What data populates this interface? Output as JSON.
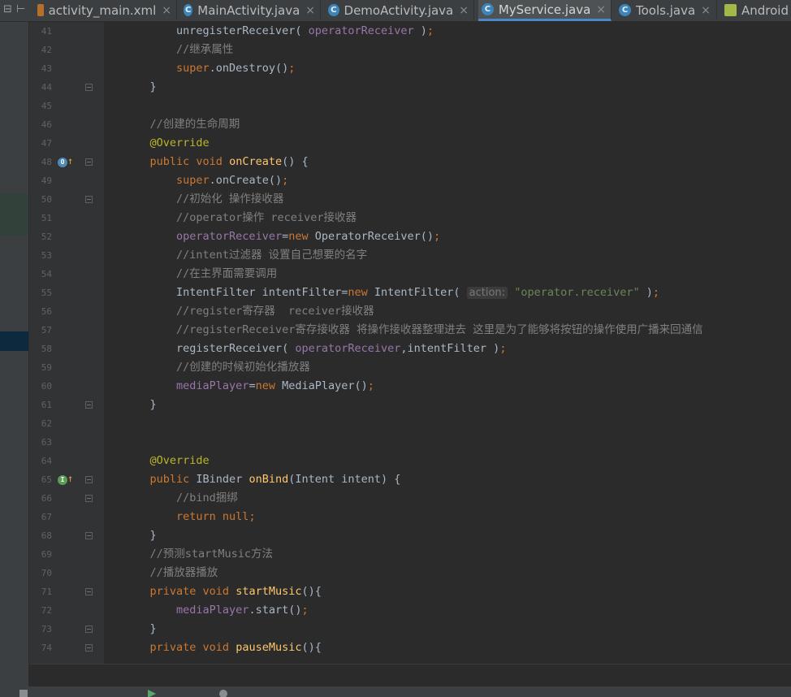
{
  "tabs": [
    {
      "label": "activity_main.xml",
      "icon": "xml-file-icon",
      "active": false
    },
    {
      "label": "MainActivity.java",
      "icon": "class-icon",
      "active": false
    },
    {
      "label": "DemoActivity.java",
      "icon": "class-icon",
      "active": false
    },
    {
      "label": "MyService.java",
      "icon": "class-icon",
      "active": true
    },
    {
      "label": "Tools.java",
      "icon": "class-icon",
      "active": false
    },
    {
      "label": "Android",
      "icon": "android-icon",
      "active": false
    }
  ],
  "tab_close_glyph": "×",
  "class_glyph": "C",
  "gutter": {
    "line_numbers": [
      "41",
      "42",
      "43",
      "44",
      "45",
      "46",
      "47",
      "48",
      "49",
      "50",
      "51",
      "52",
      "53",
      "54",
      "55",
      "56",
      "57",
      "58",
      "59",
      "60",
      "61",
      "62",
      "63",
      "64",
      "65",
      "66",
      "67",
      "68",
      "69",
      "70",
      "71",
      "72",
      "73",
      "74"
    ],
    "marks": {
      "override_glyph": "O",
      "implement_glyph": "I",
      "arrow_glyph": "↑"
    }
  },
  "code": [
    [
      {
        "t": "        unregisterReceiver( "
      },
      {
        "t": "operatorReceiver",
        "c": "fd"
      },
      {
        "t": " )"
      },
      {
        "t": ";",
        "c": "kw"
      }
    ],
    [
      {
        "t": "        //继承属性",
        "c": "cm"
      }
    ],
    [
      {
        "t": "        "
      },
      {
        "t": "super",
        "c": "kw"
      },
      {
        "t": ".onDestroy()"
      },
      {
        "t": ";",
        "c": "kw"
      }
    ],
    [
      {
        "t": "    }"
      }
    ],
    [
      {
        "t": ""
      }
    ],
    [
      {
        "t": "    //创建的生命周期",
        "c": "cm"
      }
    ],
    [
      {
        "t": "    "
      },
      {
        "t": "@Override",
        "c": "an"
      }
    ],
    [
      {
        "t": "    "
      },
      {
        "t": "public void ",
        "c": "kw"
      },
      {
        "t": "onCreate",
        "c": "fn"
      },
      {
        "t": "() {"
      }
    ],
    [
      {
        "t": "        "
      },
      {
        "t": "super",
        "c": "kw"
      },
      {
        "t": ".onCreate()"
      },
      {
        "t": ";",
        "c": "kw"
      }
    ],
    [
      {
        "t": "        //初始化 操作接收器",
        "c": "cm"
      }
    ],
    [
      {
        "t": "        //operator操作 receiver接收器",
        "c": "cm"
      }
    ],
    [
      {
        "t": "        "
      },
      {
        "t": "operatorReceiver",
        "c": "fd"
      },
      {
        "t": "="
      },
      {
        "t": "new ",
        "c": "kw"
      },
      {
        "t": "OperatorReceiver()"
      },
      {
        "t": ";",
        "c": "kw"
      }
    ],
    [
      {
        "t": "        //intent过滤器 设置自己想要的名字",
        "c": "cm"
      }
    ],
    [
      {
        "t": "        //在主界面需要调用",
        "c": "cm"
      }
    ],
    [
      {
        "t": "        IntentFilter intentFilter="
      },
      {
        "t": "new ",
        "c": "kw"
      },
      {
        "t": "IntentFilter( "
      },
      {
        "t": "action:",
        "c": "hint"
      },
      {
        "t": " "
      },
      {
        "t": "\"operator.receiver\"",
        "c": "st"
      },
      {
        "t": " )"
      },
      {
        "t": ";",
        "c": "kw"
      }
    ],
    [
      {
        "t": "        //register寄存器  receiver接收器",
        "c": "cm"
      }
    ],
    [
      {
        "t": "        //registerReceiver寄存接收器 将操作接收器整理进去 这里是为了能够将按钮的操作使用广播来回通信",
        "c": "cm"
      }
    ],
    [
      {
        "t": "        registerReceiver( "
      },
      {
        "t": "operatorReceiver",
        "c": "fd"
      },
      {
        "t": ","
      },
      {
        "t": "intentFilter )"
      },
      {
        "t": ";",
        "c": "kw"
      }
    ],
    [
      {
        "t": "        //创建的时候初始化播放器",
        "c": "cm"
      }
    ],
    [
      {
        "t": "        "
      },
      {
        "t": "mediaPlayer",
        "c": "fd"
      },
      {
        "t": "="
      },
      {
        "t": "new ",
        "c": "kw"
      },
      {
        "t": "MediaPlayer()"
      },
      {
        "t": ";",
        "c": "kw"
      }
    ],
    [
      {
        "t": "    }"
      }
    ],
    [
      {
        "t": ""
      }
    ],
    [
      {
        "t": ""
      }
    ],
    [
      {
        "t": "    "
      },
      {
        "t": "@Override",
        "c": "an"
      }
    ],
    [
      {
        "t": "    "
      },
      {
        "t": "public ",
        "c": "kw"
      },
      {
        "t": "IBinder "
      },
      {
        "t": "onBind",
        "c": "fn"
      },
      {
        "t": "(Intent intent) {"
      }
    ],
    [
      {
        "t": "        //bind捆绑",
        "c": "cm"
      }
    ],
    [
      {
        "t": "        "
      },
      {
        "t": "return null",
        "c": "kw"
      },
      {
        "t": ";",
        "c": "kw"
      }
    ],
    [
      {
        "t": "    }"
      }
    ],
    [
      {
        "t": "    //预测startMusic方法",
        "c": "cm"
      }
    ],
    [
      {
        "t": "    //播放器播放",
        "c": "cm"
      }
    ],
    [
      {
        "t": "    "
      },
      {
        "t": "private void ",
        "c": "kw"
      },
      {
        "t": "startMusic",
        "c": "fn"
      },
      {
        "t": "(){"
      }
    ],
    [
      {
        "t": "        "
      },
      {
        "t": "mediaPlayer",
        "c": "fd"
      },
      {
        "t": ".start()"
      },
      {
        "t": ";",
        "c": "kw"
      }
    ],
    [
      {
        "t": "    }"
      }
    ],
    [
      {
        "t": "    "
      },
      {
        "t": "private void ",
        "c": "kw"
      },
      {
        "t": "pauseMusic",
        "c": "fn"
      },
      {
        "t": "(){"
      }
    ]
  ],
  "colors": {
    "background": "#2b2b2b",
    "keyword": "#cc7832",
    "comment": "#808080",
    "annotation": "#bbb529",
    "field": "#9876aa",
    "method": "#ffc66d",
    "string": "#6a8759"
  }
}
